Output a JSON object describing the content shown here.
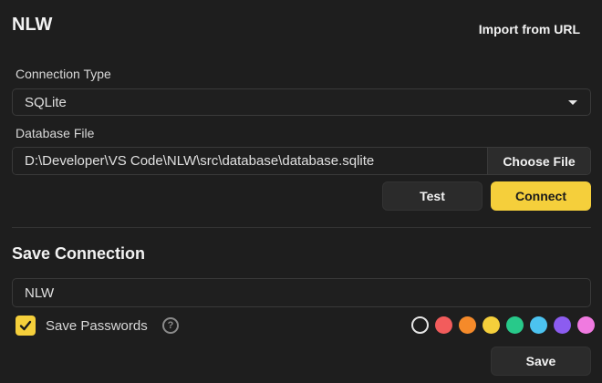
{
  "header": {
    "title": "NLW",
    "import_link": "Import from URL"
  },
  "connection": {
    "type_label": "Connection Type",
    "type_value": "SQLite",
    "file_label": "Database File",
    "file_path": "D:\\Developer\\VS Code\\NLW\\src\\database\\database.sqlite",
    "choose_file": "Choose File",
    "test": "Test",
    "connect": "Connect"
  },
  "save_section": {
    "title": "Save Connection",
    "name_value": "NLW",
    "save_passwords_label": "Save Passwords",
    "save_passwords_checked": true,
    "help_glyph": "?",
    "save": "Save"
  },
  "colors": {
    "accent": "#f5cf3b",
    "swatches": [
      "none",
      "#f25c5c",
      "#f58a2a",
      "#f5cf3b",
      "#28c98a",
      "#4cc3f0",
      "#8c5cf0",
      "#f07ae0"
    ]
  },
  "icons": {
    "select_caret": "caret-down-icon",
    "checkbox": "check-icon",
    "help": "question-circle-icon"
  }
}
